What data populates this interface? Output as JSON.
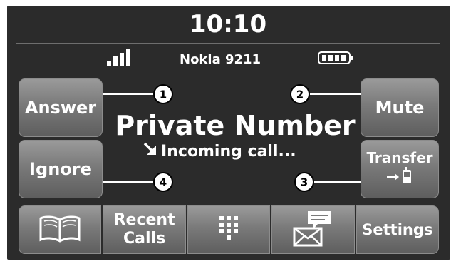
{
  "status_bar": {
    "time": "10:10",
    "device_name": "Nokia 9211",
    "signal_icon": "signal-bars-icon",
    "battery_icon": "battery-full-icon"
  },
  "call": {
    "caller": "Private Number",
    "status": "Incoming call...",
    "status_icon": "incoming-call-arrow-icon"
  },
  "buttons": {
    "answer": "Answer",
    "ignore": "Ignore",
    "mute": "Mute",
    "transfer": "Transfer",
    "transfer_icon": "transfer-to-phone-icon"
  },
  "callouts": [
    "1",
    "2",
    "3",
    "4"
  ],
  "dock": {
    "phonebook_icon": "phonebook-icon",
    "recent_calls_line1": "Recent",
    "recent_calls_line2": "Calls",
    "keypad_icon": "keypad-icon",
    "messages_icon": "messages-icon",
    "settings": "Settings"
  },
  "colors": {
    "screen_background": "#2b2b2b",
    "button_gradient_top": "#9a9a9a",
    "button_gradient_bottom": "#5e5e5e",
    "text": "#ffffff"
  }
}
